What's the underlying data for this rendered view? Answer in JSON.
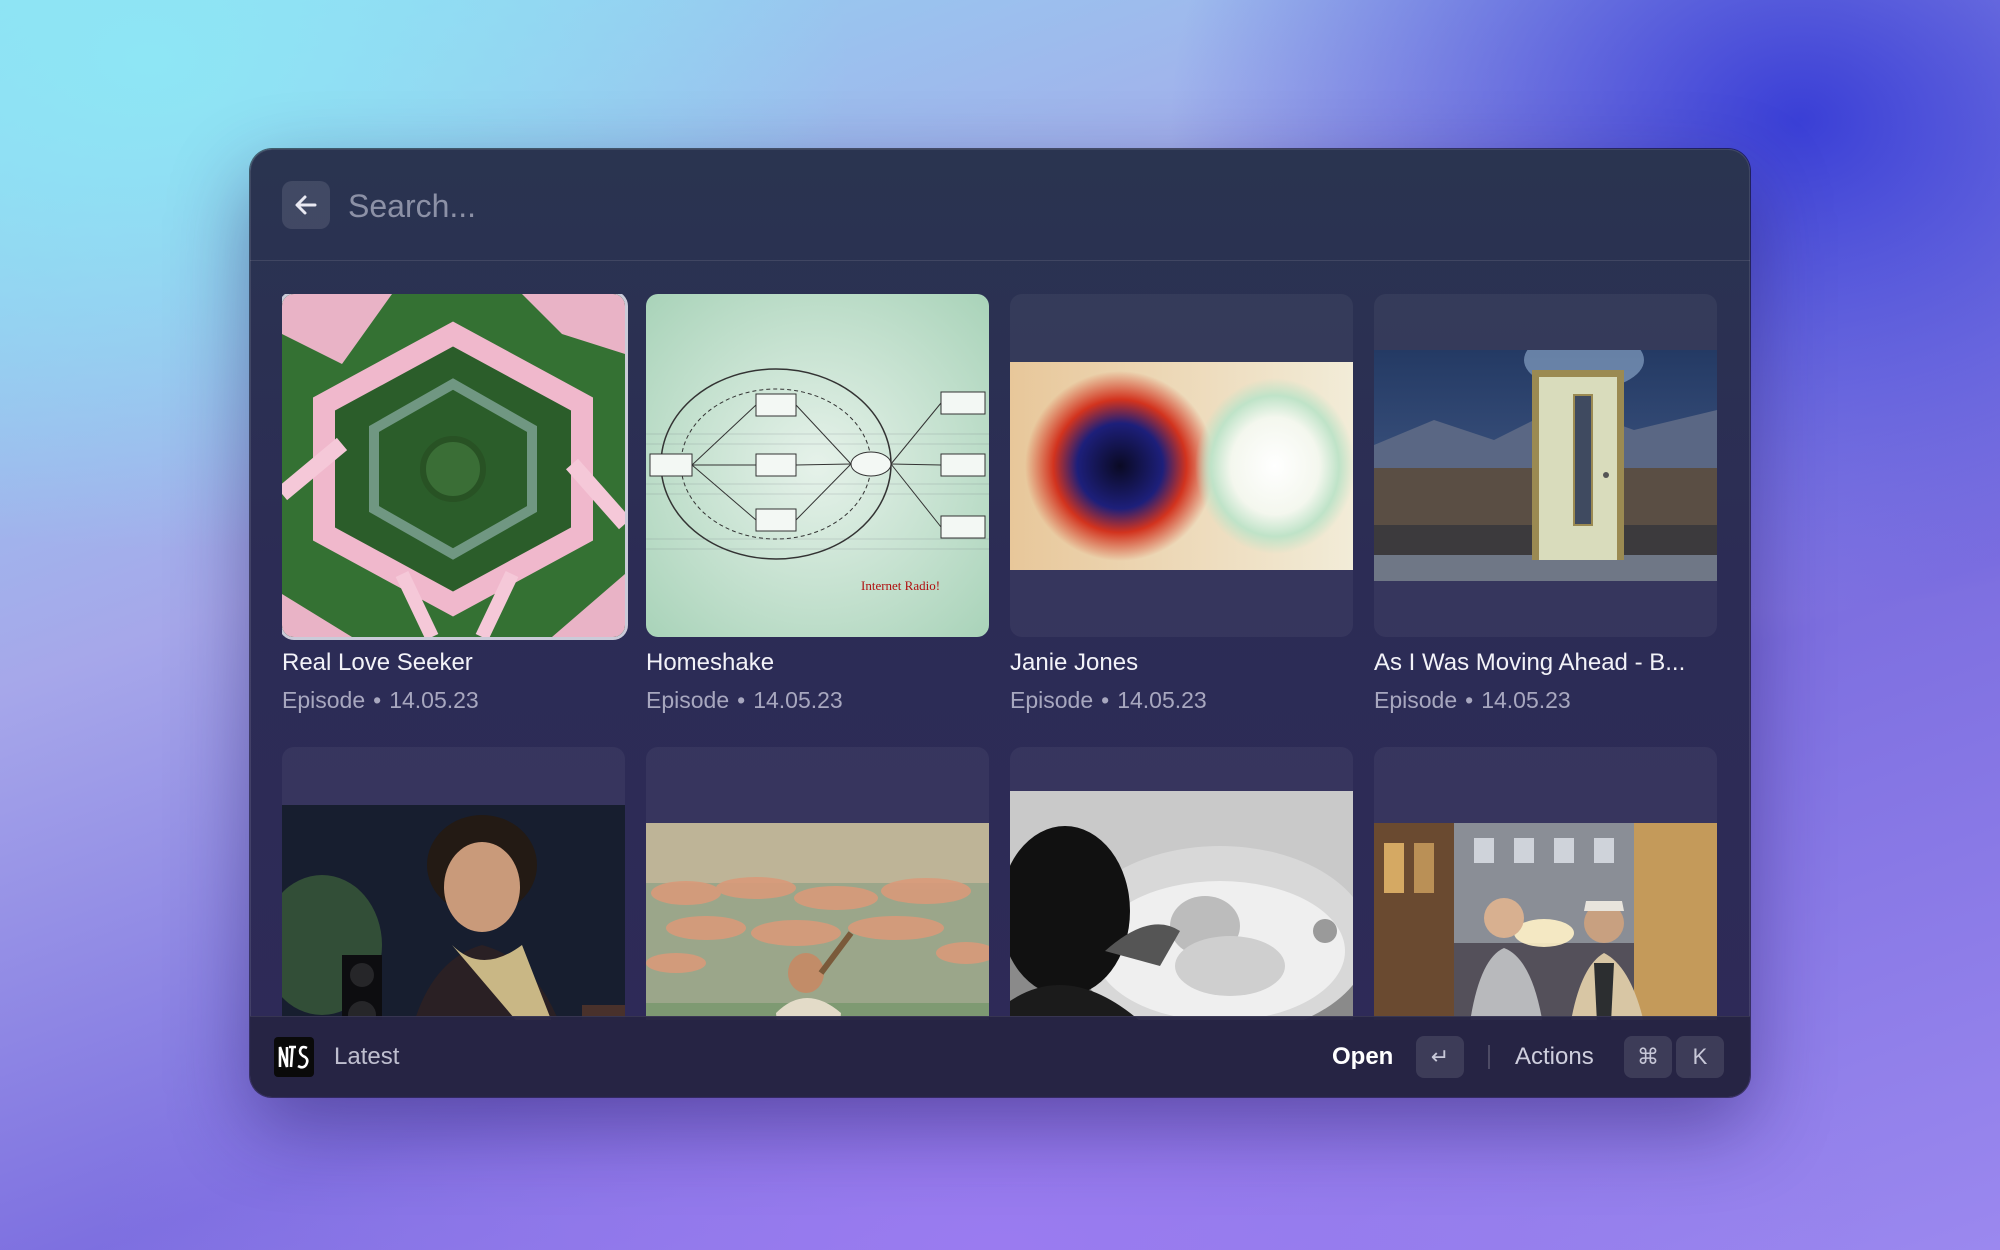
{
  "search": {
    "placeholder": "Search..."
  },
  "back_icon": "arrow-left-icon",
  "items": [
    {
      "title": "Real Love Seeker",
      "type": "Episode",
      "date": "14.05.23",
      "selected": true
    },
    {
      "title": "Homeshake",
      "type": "Episode",
      "date": "14.05.23",
      "art_text": "Internet Radio!"
    },
    {
      "title": "Janie Jones",
      "type": "Episode",
      "date": "14.05.23"
    },
    {
      "title": "As I Was Moving Ahead - B...",
      "type": "Episode",
      "date": "14.05.23"
    },
    {
      "title": "",
      "type": "",
      "date": ""
    },
    {
      "title": "",
      "type": "",
      "date": ""
    },
    {
      "title": "",
      "type": "",
      "date": ""
    },
    {
      "title": "",
      "type": "",
      "date": ""
    }
  ],
  "footer": {
    "app_logo": "NTS",
    "title": "Latest",
    "primary_action": "Open",
    "primary_key": "↵",
    "actions_label": "Actions",
    "actions_keys": [
      "⌘",
      "K"
    ]
  },
  "colors": {
    "window_bg": "#2c2c55",
    "accent_text": "#ffffff",
    "secondary_text": "#d7d7e8"
  }
}
